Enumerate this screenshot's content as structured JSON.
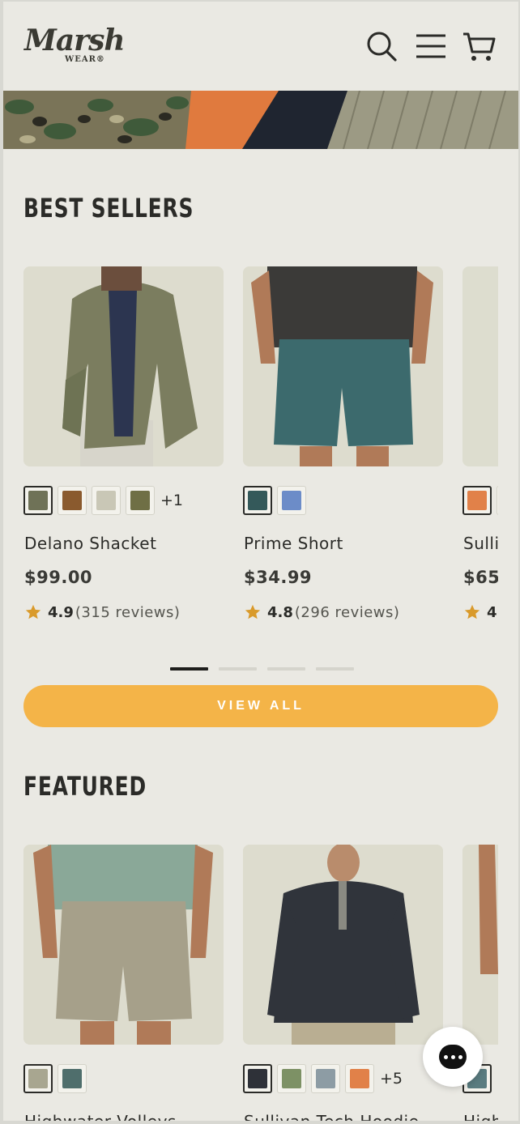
{
  "header": {
    "logo_script": "Marsh",
    "logo_sub": "WEAR®",
    "icons": [
      "search-icon",
      "menu-icon",
      "cart-icon"
    ]
  },
  "banner": {
    "swatches": [
      "camo",
      "orange",
      "navy",
      "olive-waffle"
    ]
  },
  "best_sellers": {
    "title": "BEST SELLERS",
    "products": [
      {
        "name": "Delano Shacket",
        "price": "$99.00",
        "score": "4.9",
        "reviews": "(315 reviews)",
        "swatch_colors": [
          "#6f7257",
          "#8a5a2e",
          "#c9c7b6",
          "#6f6f45"
        ],
        "more": "+1"
      },
      {
        "name": "Prime Short",
        "price": "$34.99",
        "score": "4.8",
        "reviews": "(296 reviews)",
        "swatch_colors": [
          "#34595a",
          "#6c8cc8"
        ],
        "more": ""
      },
      {
        "name": "Sulli",
        "price": "$65",
        "score": "4.",
        "reviews": "",
        "swatch_colors": [
          "#e18149"
        ],
        "more": ""
      }
    ],
    "view_all_label": "VIEW ALL",
    "carousel_pages": 4,
    "active_page": 1
  },
  "featured": {
    "title": "FEATURED",
    "products": [
      {
        "name": "Highwater Volleys",
        "swatch_colors": [
          "#a8a690",
          "#4f6e6c"
        ],
        "more": ""
      },
      {
        "name": "Sullivan Tech Hoodie",
        "swatch_colors": [
          "#2e3138",
          "#7d9165",
          "#8d9ca4",
          "#e18149"
        ],
        "more": "+5"
      },
      {
        "name": "High",
        "swatch_colors": [
          "#5a7c80"
        ],
        "more": ""
      }
    ]
  },
  "colors": {
    "background": "#eae9e3",
    "accent_button": "#f4b448",
    "star": "#d99a2b",
    "text": "#2b2b28"
  },
  "chat": {
    "icon": "chat-bubble-icon"
  }
}
